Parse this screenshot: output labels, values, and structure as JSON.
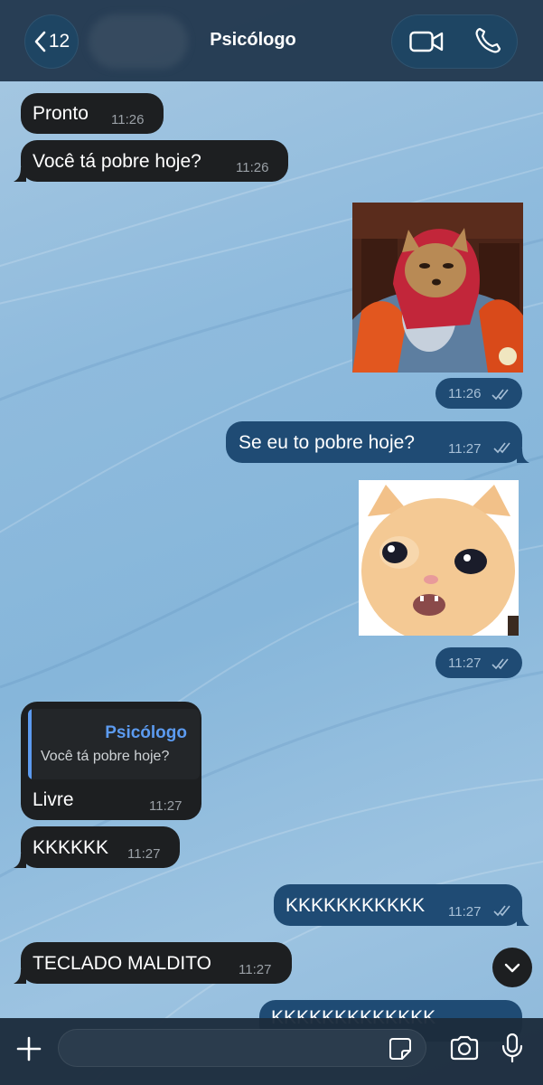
{
  "header": {
    "back_count": "12",
    "title": "Psicólogo"
  },
  "messages": {
    "m1": {
      "text": "Pronto",
      "time": "11:26"
    },
    "m2": {
      "text": "Você tá pobre hoje?",
      "time": "11:26"
    },
    "m3": {
      "time": "11:26"
    },
    "m4": {
      "text": "Se eu to pobre hoje?",
      "time": "11:27"
    },
    "m5": {
      "time": "11:27"
    },
    "m6": {
      "reply_name": "Psicólogo",
      "reply_text": "Você tá pobre hoje?",
      "text": "Livre",
      "time": "11:27"
    },
    "m7": {
      "text": "KKKKKK",
      "time": "11:27"
    },
    "m8": {
      "text": "KKKKKKKKKKK",
      "time": "11:27"
    },
    "m9": {
      "text": "TECLADO MALDITO",
      "time": "11:27"
    },
    "m10": {
      "text": "KKKKKKKKKKKKK"
    }
  },
  "input": {
    "placeholder": ""
  },
  "colors": {
    "incoming_bubble": "#1d1f21",
    "outgoing_bubble": "#1f4b74",
    "accent": "#5c9bf0",
    "header": "#1e344a"
  },
  "icons": [
    "back-chevron-icon",
    "video-call-icon",
    "phone-icon",
    "double-check-icon",
    "chevron-down-icon",
    "plus-icon",
    "sticker-icon",
    "camera-icon",
    "microphone-icon"
  ]
}
